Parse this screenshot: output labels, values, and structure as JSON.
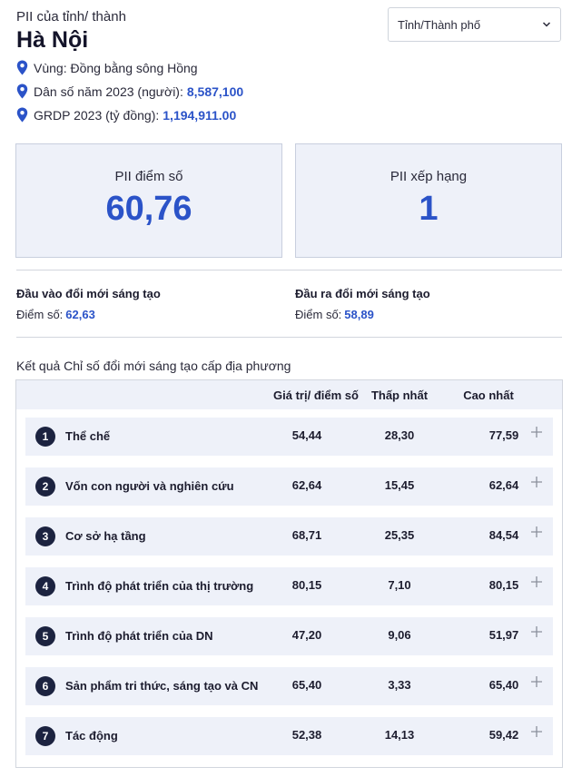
{
  "header": {
    "kicker": "PII của tỉnh/ thành",
    "province": "Hà Nội",
    "select_label": "Tỉnh/Thành phố"
  },
  "meta": [
    {
      "label": "Vùng: Đồng bằng sông Hồng",
      "value": ""
    },
    {
      "label": "Dân số năm 2023 (người):",
      "value": "8,587,100"
    },
    {
      "label": "GRDP 2023 (tỷ đồng):",
      "value": "1,194,911.00"
    }
  ],
  "cards": {
    "score_label": "PII điểm số",
    "score_value": "60,76",
    "rank_label": "PII xếp hạng",
    "rank_value": "1"
  },
  "sub_indices": {
    "input": {
      "title": "Đầu vào đổi mới sáng tạo",
      "score_label": "Điểm số:",
      "score": "62,63"
    },
    "output": {
      "title": "Đầu ra đổi mới sáng tạo",
      "score_label": "Điểm số:",
      "score": "58,89"
    }
  },
  "results": {
    "caption": "Kết quả Chỉ số đổi mới sáng tạo cấp địa phương",
    "headers": {
      "value": "Giá trị/ điểm số",
      "min": "Thấp nhất",
      "max": "Cao nhất"
    },
    "rows": [
      {
        "num": "1",
        "name": "Thể chế",
        "value": "54,44",
        "min": "28,30",
        "max": "77,59"
      },
      {
        "num": "2",
        "name": "Vốn con người và nghiên cứu",
        "value": "62,64",
        "min": "15,45",
        "max": "62,64"
      },
      {
        "num": "3",
        "name": "Cơ sở hạ tầng",
        "value": "68,71",
        "min": "25,35",
        "max": "84,54"
      },
      {
        "num": "4",
        "name": "Trình độ phát triển của thị trường",
        "value": "80,15",
        "min": "7,10",
        "max": "80,15"
      },
      {
        "num": "5",
        "name": "Trình độ phát triển của DN",
        "value": "47,20",
        "min": "9,06",
        "max": "51,97"
      },
      {
        "num": "6",
        "name": "Sản phẩm tri thức, sáng tạo và CN",
        "value": "65,40",
        "min": "3,33",
        "max": "65,40"
      },
      {
        "num": "7",
        "name": "Tác động",
        "value": "52,38",
        "min": "14,13",
        "max": "59,42"
      }
    ]
  },
  "icons": {
    "location": "map-pin-icon",
    "expand": "plus-icon",
    "dropdown": "chevron-down-icon"
  },
  "colors": {
    "accent": "#2b53c8",
    "badge": "#1c2340",
    "card_bg": "#eef1f9"
  }
}
